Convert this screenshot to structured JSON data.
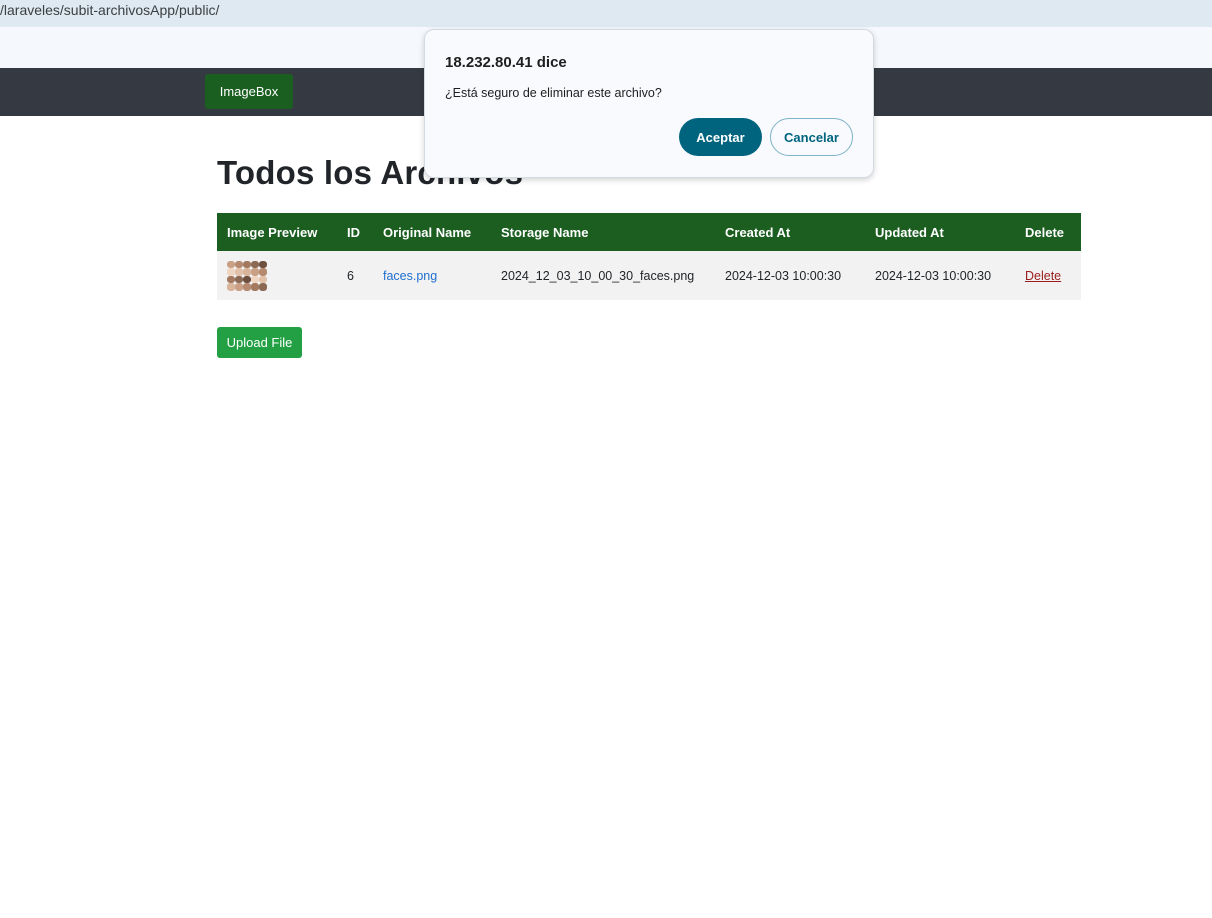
{
  "browser": {
    "url": "/laraveles/subit-archivosApp/public/"
  },
  "navbar": {
    "brand": "ImageBox"
  },
  "page": {
    "title": "Todos los Archivos"
  },
  "table": {
    "headers": [
      "Image Preview",
      "ID",
      "Original Name",
      "Storage Name",
      "Created At",
      "Updated At",
      "Delete"
    ],
    "rows": [
      {
        "thumbnail": "faces-thumbnail",
        "id": "6",
        "original_name": "faces.png",
        "storage_name": "2024_12_03_10_00_30_faces.png",
        "created_at": "2024-12-03 10:00:30",
        "updated_at": "2024-12-03 10:00:30",
        "delete_label": "Delete"
      }
    ]
  },
  "actions": {
    "upload_label": "Upload File"
  },
  "dialog": {
    "origin": "18.232.80.41 dice",
    "message": "¿Está seguro de eliminar este archivo?",
    "ok_label": "Aceptar",
    "cancel_label": "Cancelar"
  },
  "colors": {
    "navbar": "#353a42",
    "brand_bg": "#1a5e20",
    "table_header": "#1b5e20",
    "upload_button": "#22a043",
    "link": "#1f6fd1",
    "delete_link": "#9b1c1c",
    "dialog_primary": "#00647e"
  }
}
